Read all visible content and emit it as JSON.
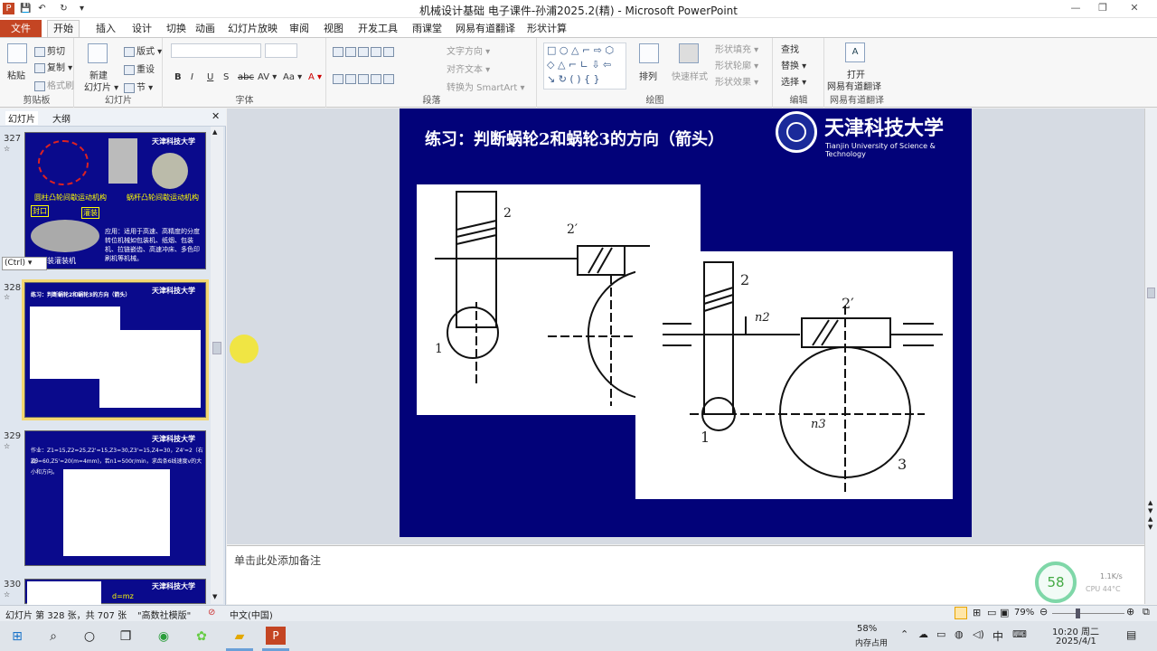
{
  "window": {
    "title": "机械设计基础 电子课件-孙浦2025.2(精) - Microsoft PowerPoint",
    "controls": [
      "—",
      "❐",
      "✕"
    ],
    "quick_access": [
      "P",
      "💾",
      "↶",
      "↻",
      "▾"
    ]
  },
  "tabs": {
    "file": "文件",
    "items": [
      "开始",
      "插入",
      "设计",
      "切换",
      "动画",
      "幻灯片放映",
      "审阅",
      "视图",
      "开发工具",
      "雨课堂",
      "网易有道翻译",
      "形状计算"
    ]
  },
  "ribbon": {
    "clipboard": {
      "label": "剪贴板",
      "paste": "粘贴",
      "cut": "剪切",
      "copy": "复制 ▾",
      "format": "格式刷"
    },
    "slides": {
      "label": "幻灯片",
      "new": "新建",
      "new2": "幻灯片 ▾",
      "layout": "版式 ▾",
      "reset": "重设",
      "section": "节 ▾"
    },
    "font": {
      "label": "字体",
      "buttons": [
        "B",
        "I",
        "U",
        "S",
        "abc",
        "AV ▾",
        "Aa ▾",
        "A ▾"
      ]
    },
    "paragraph": {
      "label": "段落",
      "text_direction": "文字方向 ▾",
      "align_text": "对齐文本 ▾",
      "smartart": "转换为 SmartArt ▾"
    },
    "drawing": {
      "label": "绘图",
      "arrange": "排列",
      "quick_styles": "快速样式",
      "fill": "形状填充 ▾",
      "outline": "形状轮廓 ▾",
      "effects": "形状效果 ▾"
    },
    "editing": {
      "label": "编辑",
      "find": "查找",
      "replace": "替换 ▾",
      "select": "选择 ▾"
    },
    "youdao": {
      "label": "网易有道翻译",
      "open": "打开",
      "open2": "网易有道翻译"
    }
  },
  "left_pane": {
    "tabs": [
      "幻灯片",
      "大纲"
    ],
    "close": "✕",
    "slides": [
      {
        "number": "327",
        "logo": "天津科技大学",
        "captions": [
          "圆柱凸轮间歇运动机构",
          "蜗杆凸轮间歇运动机构"
        ],
        "labels": [
          "封口",
          "灌装"
        ],
        "text": "应用：适用于高速、高精度的分度转位机械如包装机、纸烟、包装机、拉链嵌齿、高速冲床、多色印刷机等机械。",
        "extra": "装灌装机"
      },
      {
        "number": "328",
        "logo": "天津科技大学",
        "title": "练习：判断蜗轮2和蜗轮3的方向（箭头）"
      },
      {
        "number": "329",
        "logo": "天津科技大学",
        "text1": "作业：Z1=15,Z2=25,Z2'=15,Z3=30,Z3'=15,Z4=30，Z4'=2（右旋）",
        "text2": "Z5=60,Z5'=20(m=4mm)，若n1=500r/min，求齿条6线速度v的大小和方向。"
      },
      {
        "number": "330",
        "logo": "天津科技大学",
        "text": "d=mz"
      }
    ],
    "ctrl_popup": "(Ctrl) ▾"
  },
  "slide": {
    "title": "练习：判断蜗轮2和蜗轮3的方向（箭头）",
    "logo_text": "天津科技大学",
    "logo_sub": "Tianjin University of Science & Technology",
    "fig1_labels": [
      "2",
      "2′",
      "1"
    ],
    "fig2_labels": [
      "2",
      "2′",
      "n2",
      "1",
      "n3",
      "3"
    ]
  },
  "notes": {
    "placeholder": "单击此处添加备注"
  },
  "status": {
    "slide_info": "幻灯片 第 328 张，共 707 张",
    "theme": "\"高数社模版\"",
    "language": "中文(中国)",
    "zoom": "79%"
  },
  "perf": {
    "percent": "58",
    "net": "1.1K/s",
    "cpu": "CPU 44°C"
  },
  "taskbar": {
    "mem_percent": "58%",
    "mem_label": "内存占用",
    "ime": "中",
    "time": "10:20 周二",
    "date": "2025/4/1"
  }
}
